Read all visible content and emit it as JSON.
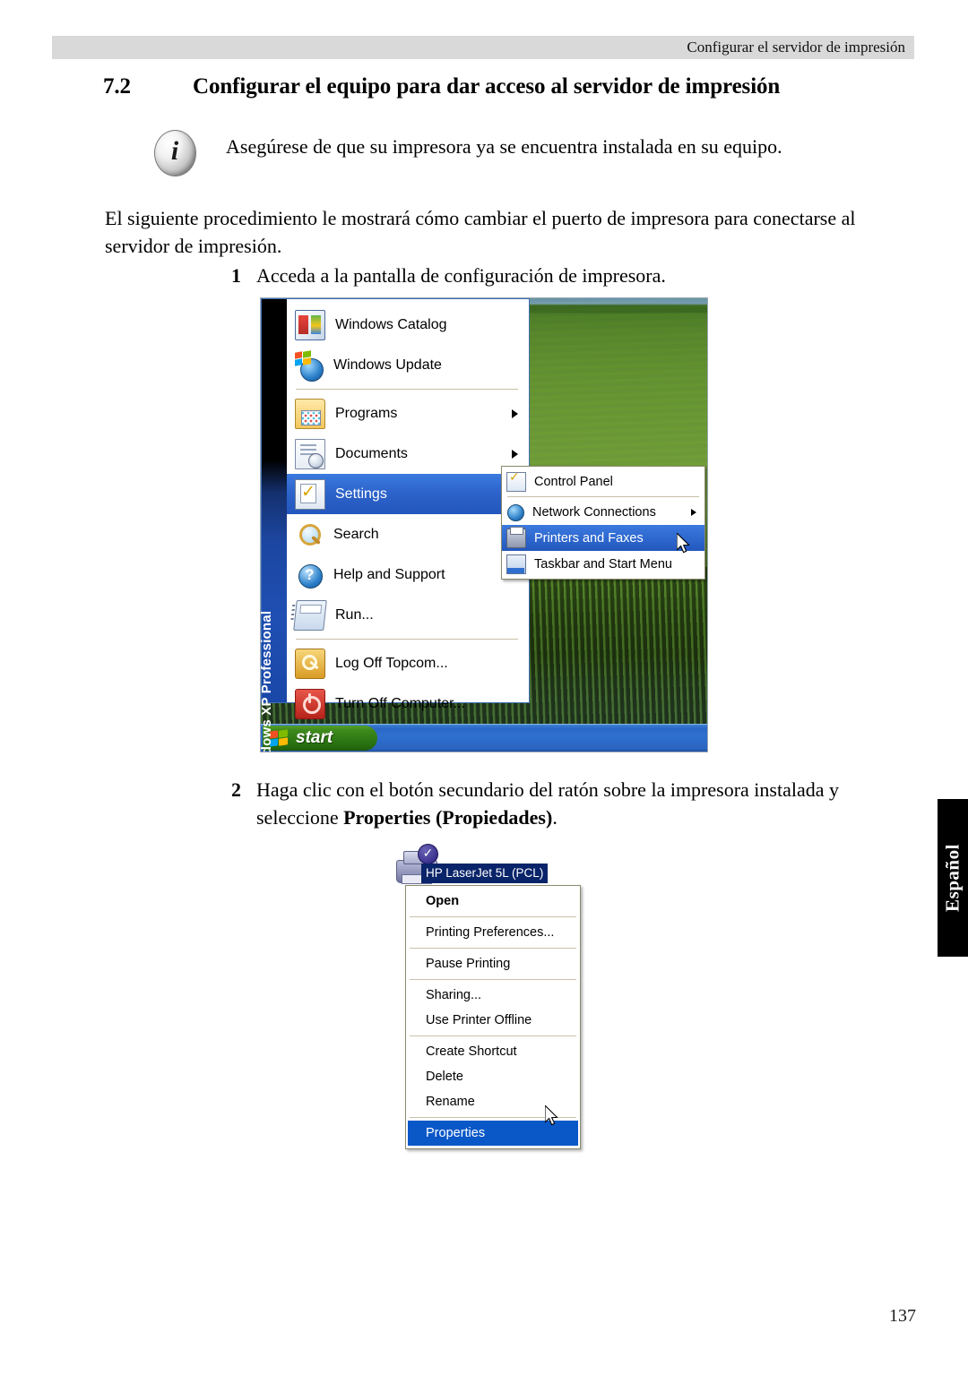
{
  "header": {
    "running_title": "Configurar el servidor de impresión"
  },
  "section": {
    "number": "7.2",
    "title": "Configurar el equipo para dar acceso al servidor de impresión"
  },
  "note": {
    "icon": "info-icon",
    "glyph": "i",
    "text": "Asegúrese de que su impresora ya se encuentra instalada en su equipo."
  },
  "intro_paragraph": "El siguiente procedimiento le mostrará cómo cambiar el puerto de impresora para conectarse al servidor de impresión.",
  "steps": [
    {
      "number": "1",
      "text": "Acceda a la pantalla de configuración de impresora."
    },
    {
      "number": "2",
      "text_before_bold": "Haga clic con el botón secundario del ratón sobre la impresora instalada y seleccione ",
      "bold": "Properties (Propiedades)",
      "text_after_bold": "."
    }
  ],
  "start_menu_screenshot": {
    "sidebar_text": "Windows XP Professional",
    "items": [
      {
        "label": "Windows Catalog",
        "icon": "windows-catalog-icon",
        "has_submenu": false,
        "selected": false
      },
      {
        "label": "Windows Update",
        "icon": "windows-update-icon",
        "has_submenu": false,
        "selected": false
      },
      {
        "label": "Programs",
        "icon": "programs-folder-icon",
        "has_submenu": true,
        "selected": false
      },
      {
        "label": "Documents",
        "icon": "documents-icon",
        "has_submenu": true,
        "selected": false
      },
      {
        "label": "Settings",
        "icon": "settings-icon",
        "has_submenu": true,
        "selected": true
      },
      {
        "label": "Search",
        "icon": "search-magnifier-icon",
        "has_submenu": true,
        "selected": false
      },
      {
        "label": "Help and Support",
        "icon": "help-question-icon",
        "has_submenu": false,
        "selected": false
      },
      {
        "label": "Run...",
        "icon": "run-icon",
        "has_submenu": false,
        "selected": false
      },
      {
        "label": "Log Off Topcom...",
        "icon": "log-off-key-icon",
        "has_submenu": false,
        "selected": false
      },
      {
        "label": "Turn Off Computer...",
        "icon": "turn-off-power-icon",
        "has_submenu": false,
        "selected": false
      }
    ],
    "settings_submenu": [
      {
        "label": "Control Panel",
        "icon": "control-panel-icon",
        "has_submenu": false,
        "selected": false
      },
      {
        "label": "Network Connections",
        "icon": "network-globe-icon",
        "has_submenu": true,
        "selected": false
      },
      {
        "label": "Printers and Faxes",
        "icon": "printer-icon",
        "has_submenu": false,
        "selected": true
      },
      {
        "label": "Taskbar and Start Menu",
        "icon": "taskbar-start-menu-icon",
        "has_submenu": false,
        "selected": false
      }
    ],
    "taskbar": {
      "start_label": "start",
      "start_icon": "windows-flag-icon"
    },
    "colors": {
      "selection_blue": "#2c62c9",
      "taskbar_blue": "#2f70cf",
      "start_green": "#3f8a1c",
      "sidebar_blue": "#1f4fb3"
    }
  },
  "printer_context_screenshot": {
    "printer_icon": "printer-icon",
    "default_badge": "default-printer-check-icon",
    "printer_name": "HP LaserJet 5L (PCL)",
    "menu_items": [
      {
        "label": "Open",
        "bold": true,
        "selected": false,
        "divider_after": true
      },
      {
        "label": "Printing Preferences...",
        "bold": false,
        "selected": false,
        "divider_after": true
      },
      {
        "label": "Pause Printing",
        "bold": false,
        "selected": false,
        "divider_after": true
      },
      {
        "label": "Sharing...",
        "bold": false,
        "selected": false,
        "divider_after": false
      },
      {
        "label": "Use Printer Offline",
        "bold": false,
        "selected": false,
        "divider_after": true
      },
      {
        "label": "Create Shortcut",
        "bold": false,
        "selected": false,
        "divider_after": false
      },
      {
        "label": "Delete",
        "bold": false,
        "selected": false,
        "divider_after": false
      },
      {
        "label": "Rename",
        "bold": false,
        "selected": false,
        "divider_after": true
      },
      {
        "label": "Properties",
        "bold": false,
        "selected": true,
        "divider_after": false
      }
    ],
    "colors": {
      "selection_blue": "#0a58c8",
      "label_highlight": "#0a246a"
    }
  },
  "side_tab": {
    "label": "Español"
  },
  "page_number": "137"
}
